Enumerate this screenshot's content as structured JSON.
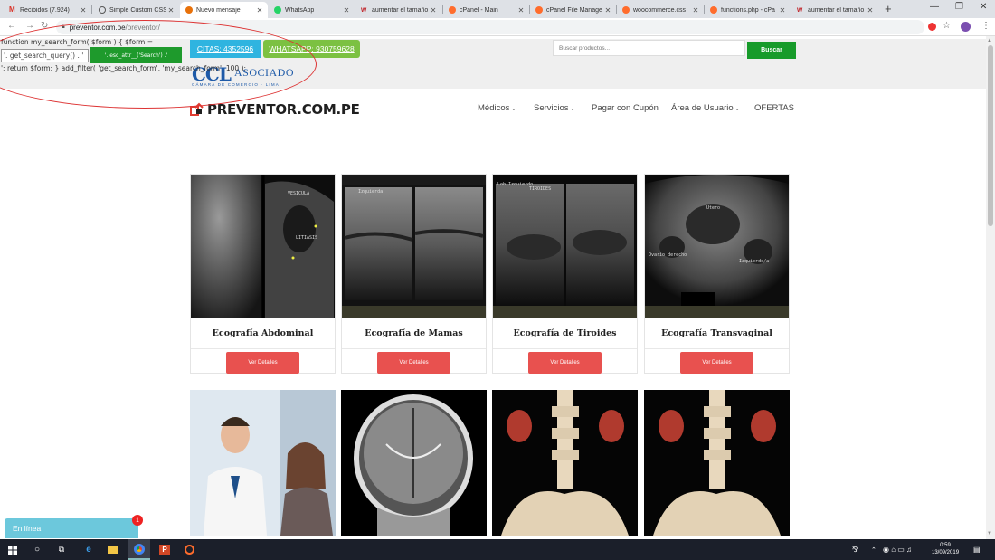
{
  "browser": {
    "tabs": [
      {
        "title": "Recibidos (7.924)",
        "color": "#d93025",
        "glyph": "M"
      },
      {
        "title": "Simple Custom CSS",
        "color": "#444444",
        "glyph": ""
      },
      {
        "title": "Nuevo mensaje",
        "color": "#e8710a",
        "glyph": "",
        "active": true
      },
      {
        "title": "WhatsApp",
        "color": "#25d366",
        "glyph": ""
      },
      {
        "title": "aumentar el tamaño",
        "color": "#c1272d",
        "glyph": "w"
      },
      {
        "title": "cPanel - Main",
        "color": "#ff6c2c",
        "glyph": ""
      },
      {
        "title": "cPanel File Manage",
        "color": "#ff6c2c",
        "glyph": ""
      },
      {
        "title": "woocommerce.css",
        "color": "#ff6c2c",
        "glyph": ""
      },
      {
        "title": "functions.php - cPa",
        "color": "#ff6c2c",
        "glyph": ""
      },
      {
        "title": "aumentar el tamaño",
        "color": "#c1272d",
        "glyph": "w"
      }
    ],
    "new_tab": "+",
    "url_host": "preventor.com.pe",
    "url_path": "/preventor/"
  },
  "code_overlay": {
    "line1": "function my_search_form( $form ) { $form = '",
    "line2_input": "'. get_search_query() . '",
    "line2_button": "'. esc_attr__('Search') .'",
    "line3": "'; return $form; } add_filter( 'get_search_form', 'my_search_form', 100 );"
  },
  "topbar": {
    "citas": "CITAS: 4352596",
    "whatsapp": "WHATSAPP: 930759628",
    "search_placeholder": "Buscar productos...",
    "search_button": "Buscar",
    "ccl_mark": "CCL",
    "ccl_label": "ASOCIADO",
    "ccl_sub": "CÁMARA DE COMERCIO · LIMA"
  },
  "header": {
    "brand": "PREVENTOR.COM.PE",
    "nav": [
      {
        "label": "Médicos",
        "dropdown": true
      },
      {
        "label": "Servicios",
        "dropdown": true
      },
      {
        "label": "Pagar con Cupón",
        "dropdown": false
      },
      {
        "label": "Área de Usuario",
        "dropdown": true
      },
      {
        "label": "OFERTAS",
        "dropdown": false
      }
    ]
  },
  "products": [
    {
      "title": "Ecografía Abdominal",
      "button": "Ver Detalles",
      "img_labels": [
        "VESICULA",
        "LITIASIS"
      ]
    },
    {
      "title": "Ecografía de Mamas",
      "button": "Ver Detalles",
      "img_labels": [
        "Izquierda"
      ]
    },
    {
      "title": "Ecografía de Tiroides",
      "button": "Ver Detalles",
      "img_labels": [
        "Lob Izquierdo",
        "TIROIDES"
      ]
    },
    {
      "title": "Ecografía Transvaginal",
      "button": "Ver Detalles",
      "img_labels": [
        "Utero",
        "Ovario derecho",
        "Izquierdo/a"
      ]
    }
  ],
  "chat": {
    "label": "En línea",
    "badge": "1"
  },
  "taskbar": {
    "time": "0:59",
    "date": "13/09/2019"
  },
  "colors": {
    "citas_blue": "#2fb4e0",
    "whatsapp_green": "#7cc142",
    "search_green": "#179b2a",
    "details_red": "#e8514f",
    "ccl_blue": "#1e5aa8"
  }
}
